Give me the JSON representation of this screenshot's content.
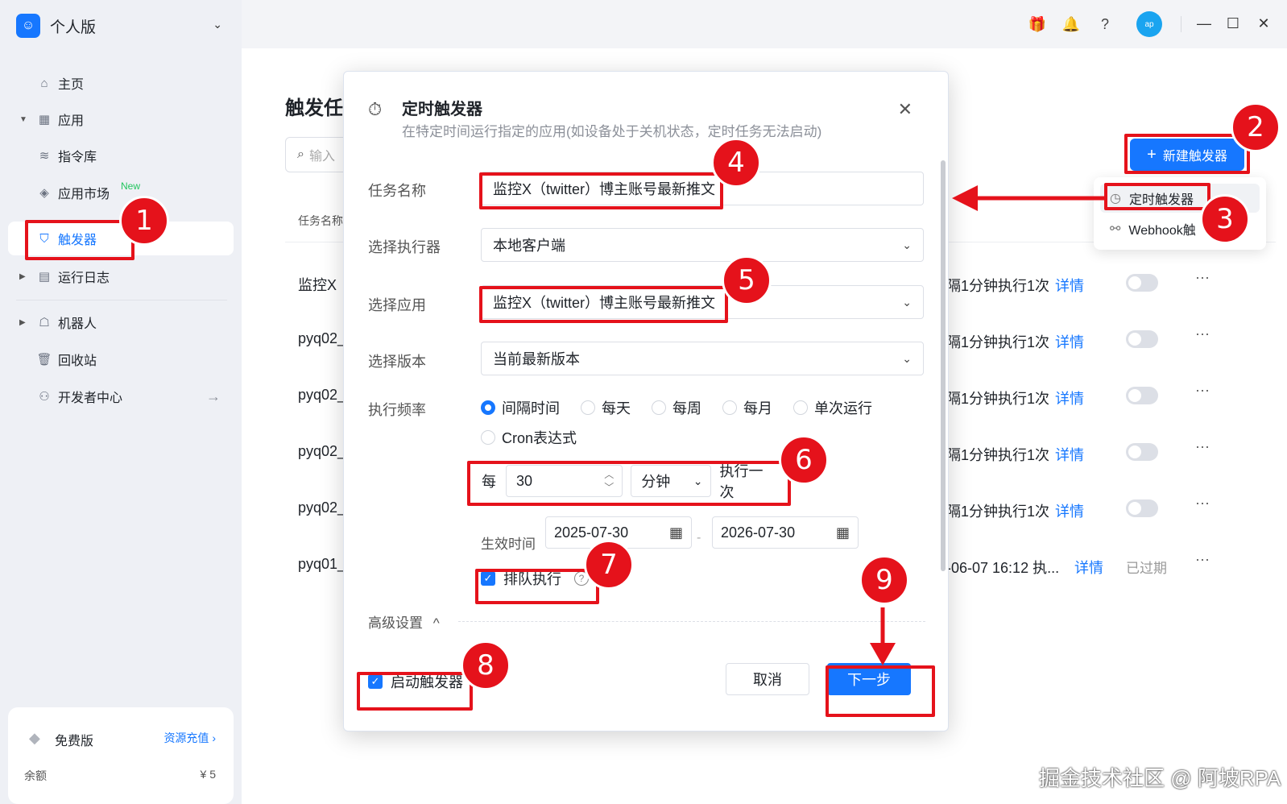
{
  "sidebar": {
    "workspace": "个人版",
    "items": [
      {
        "label": "主页"
      },
      {
        "label": "应用"
      },
      {
        "label": "指令库"
      },
      {
        "label": "应用市场",
        "badge": "New"
      },
      {
        "label": "触发器"
      },
      {
        "label": "运行日志"
      },
      {
        "label": "机器人"
      },
      {
        "label": "回收站"
      },
      {
        "label": "开发者中心"
      }
    ],
    "plan": {
      "name": "免费版",
      "recharge": "资源充值 ›",
      "balance_label": "余额",
      "balance_value": "¥ 5"
    }
  },
  "topbar": {
    "avatar": "ap"
  },
  "page": {
    "title": "触发任",
    "search_placeholder": "输入",
    "column_task_name": "任务名称",
    "new_trigger_button": "新建触发器",
    "dropdown": {
      "timed": "定时触发器",
      "webhook": "Webhook触"
    },
    "rows": [
      {
        "name": "监控X",
        "freq": "隔1分钟执行1次",
        "detail": "详情"
      },
      {
        "name": "pyq02_",
        "freq": "隔1分钟执行1次",
        "detail": "详情"
      },
      {
        "name": "pyq02_",
        "freq": "隔1分钟执行1次",
        "detail": "详情"
      },
      {
        "name": "pyq02_",
        "freq": "隔1分钟执行1次",
        "detail": "详情"
      },
      {
        "name": "pyq02_",
        "freq": "隔1分钟执行1次",
        "detail": "详情"
      },
      {
        "name": "pyq01_",
        "freq": "-06-07 16:12 执...",
        "detail": "详情",
        "status": "已过期"
      }
    ]
  },
  "modal": {
    "title": "定时触发器",
    "subtitle": "在特定时间运行指定的应用(如设备处于关机状态，定时任务无法启动)",
    "task_name_label": "任务名称",
    "task_name_value": "监控X（twitter）博主账号最新推文",
    "executor_label": "选择执行器",
    "executor_value": "本地客户端",
    "app_label": "选择应用",
    "app_value": "监控X（twitter）博主账号最新推文",
    "version_label": "选择版本",
    "version_value": "当前最新版本",
    "freq_label": "执行频率",
    "freq_options": [
      "间隔时间",
      "每天",
      "每周",
      "每月",
      "单次运行",
      "Cron表达式"
    ],
    "freq_selected": "间隔时间",
    "every_label": "每",
    "interval_value": "30",
    "interval_unit": "分钟",
    "exec_once": "执行一次",
    "effective_label": "生效时间",
    "start_date": "2025-07-30",
    "end_date": "2026-07-30",
    "queue_label": "排队执行",
    "advanced_label": "高级设置",
    "enable_label": "启动触发器",
    "cancel": "取消",
    "next": "下一步"
  },
  "annotations": [
    "1",
    "2",
    "3",
    "4",
    "5",
    "6",
    "7",
    "8",
    "9"
  ],
  "watermark": "掘金技术社区 @ 阿坡RPA",
  "colors": {
    "accent": "#1677ff",
    "annotation": "#e5121b"
  }
}
